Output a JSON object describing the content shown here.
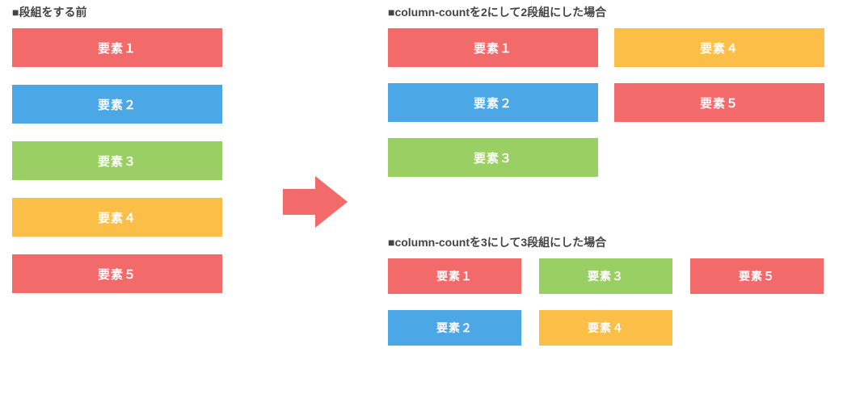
{
  "labels": {
    "before": "■段組をする前",
    "two_col": "■column-countを2にして2段組にした場合",
    "three_col": "■column-countを3にして3段組にした場合"
  },
  "elements": {
    "e1": "要素１",
    "e2": "要素２",
    "e3": "要素３",
    "e4": "要素４",
    "e5": "要素５"
  },
  "colors": {
    "red": "#f36a6a",
    "blue": "#4ca7e6",
    "green": "#9ad063",
    "orange": "#fbbf47"
  },
  "chart_data": {
    "type": "table",
    "title": "CSS column-count layout illustration",
    "items": [
      {
        "id": 1,
        "label": "要素１",
        "color": "red"
      },
      {
        "id": 2,
        "label": "要素２",
        "color": "blue"
      },
      {
        "id": 3,
        "label": "要素３",
        "color": "green"
      },
      {
        "id": 4,
        "label": "要素４",
        "color": "orange"
      },
      {
        "id": 5,
        "label": "要素５",
        "color": "red"
      }
    ],
    "layouts": {
      "before_single_column": [
        [
          1
        ],
        [
          2
        ],
        [
          3
        ],
        [
          4
        ],
        [
          5
        ]
      ],
      "column_count_2": [
        [
          1,
          2,
          3
        ],
        [
          4,
          5
        ]
      ],
      "column_count_3": [
        [
          1,
          2
        ],
        [
          3,
          4
        ],
        [
          5
        ]
      ]
    }
  }
}
